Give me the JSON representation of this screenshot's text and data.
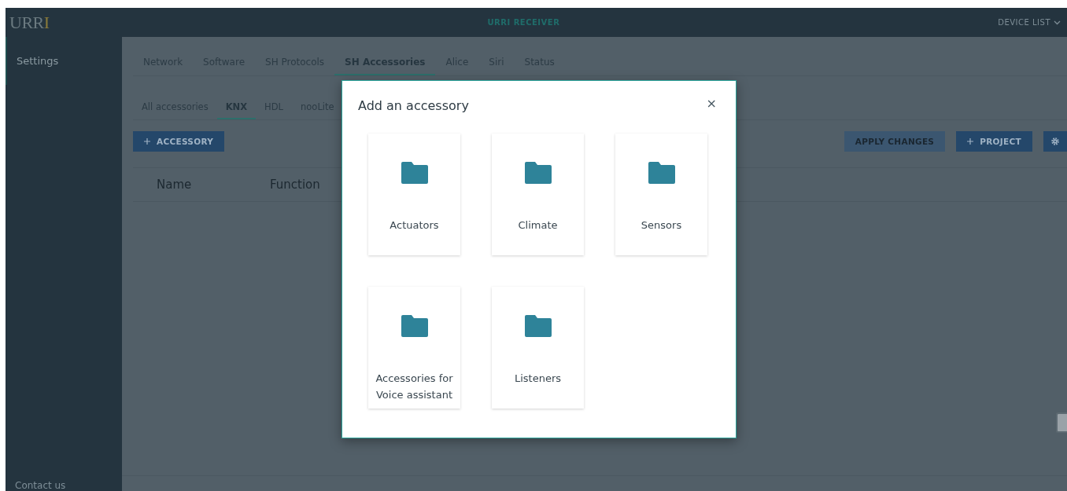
{
  "header": {
    "logo": {
      "text": "URR",
      "accent": "I"
    },
    "title": "URRI RECEIVER",
    "device_menu": "DEVICE LIST"
  },
  "sidebar": {
    "items": [
      {
        "label": "Settings",
        "selected": true
      }
    ],
    "footer": "Contact us"
  },
  "tabs": [
    {
      "label": "Network",
      "selected": false
    },
    {
      "label": "Software",
      "selected": false
    },
    {
      "label": "SH Protocols",
      "selected": false
    },
    {
      "label": "SH Accessories",
      "selected": true
    },
    {
      "label": "Alice",
      "selected": false
    },
    {
      "label": "Siri",
      "selected": false
    },
    {
      "label": "Status",
      "selected": false
    }
  ],
  "subtabs": [
    {
      "label": "All accessories",
      "selected": false
    },
    {
      "label": "KNX",
      "selected": true
    },
    {
      "label": "HDL",
      "selected": false
    },
    {
      "label": "nooLite",
      "selected": false
    }
  ],
  "toolbar": {
    "add_button": "ACCESSORY",
    "apply_button": "APPLY CHANGES",
    "project_button": "PROJECT"
  },
  "table": {
    "columns": [
      "Name",
      "Function"
    ]
  },
  "dialog": {
    "title": "Add an accessory",
    "close": "×",
    "categories": [
      {
        "label": "Actuators"
      },
      {
        "label": "Climate"
      },
      {
        "label": "Sensors"
      },
      {
        "label": "Accessories for Voice assistant"
      },
      {
        "label": "Listeners"
      }
    ]
  }
}
